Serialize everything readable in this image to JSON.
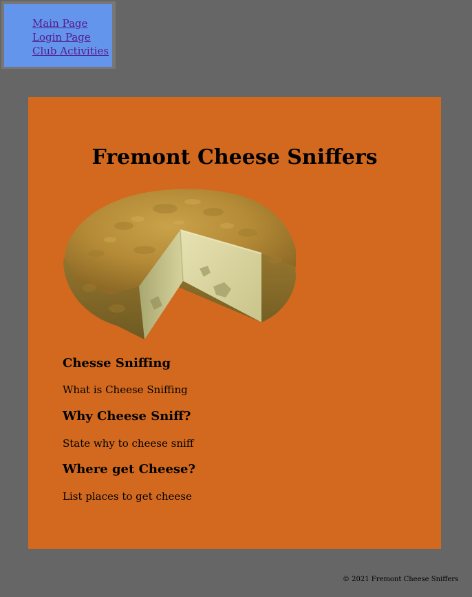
{
  "nav": {
    "items": [
      {
        "label": "Main Page"
      },
      {
        "label": "Login Page"
      },
      {
        "label": "Club Activities"
      }
    ]
  },
  "main": {
    "title": "Fremont Cheese Sniffers",
    "image": {
      "icon": "cheese-wheel-image"
    },
    "sections": [
      {
        "heading": "Chesse Sniffing",
        "text": "What is Cheese Sniffing"
      },
      {
        "heading": "Why Cheese Sniff?",
        "text": "State why to cheese sniff"
      },
      {
        "heading": "Where get Cheese?",
        "text": "List places to get cheese"
      }
    ]
  },
  "footer": {
    "text": "© 2021 Fremont Cheese Sniffers"
  },
  "colors": {
    "background": "#666666",
    "nav_background": "#6495ED",
    "panel_background": "#D2691E",
    "link": "#551A8B"
  }
}
